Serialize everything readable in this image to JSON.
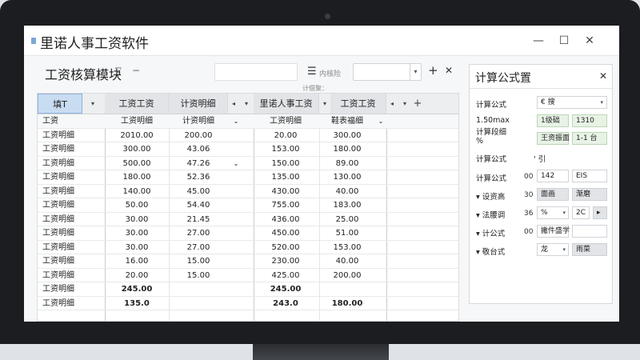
{
  "window": {
    "title": "里诺人事工资软件",
    "minimize": "—",
    "maximize": "☐",
    "close": "✕"
  },
  "module": {
    "title": "工资核算模块",
    "dropdown_arrow": "▽",
    "dash": "−",
    "list_label": "内核险",
    "plus": "+",
    "close": "✕",
    "hint": "计偿聚："
  },
  "grid": {
    "headers": [
      "填T",
      "工资工资",
      "计资明细",
      "里诺人事工资",
      "工资工资"
    ],
    "rows": [
      {
        "c0": "工资",
        "c1": "工资明细",
        "c2": "计资明细",
        "c2b": "⌄",
        "c4": "工资明细",
        "c5": "鞋表福细",
        "c5b": "⌄"
      },
      {
        "c0": "工资明细",
        "c1": "2010.00",
        "c2": "200.00",
        "c4": "20.00",
        "c5": "300.00"
      },
      {
        "c0": "工资明细",
        "c1": "300.00",
        "c2": "43.06",
        "c4": "153.00",
        "c5": "180.00"
      },
      {
        "c0": "工资明细",
        "c1": "500.00",
        "c2": "47.26",
        "c2b": "⌄",
        "c4": "150.00",
        "c5": "89.00"
      },
      {
        "c0": "工资明细",
        "c1": "180.00",
        "c2": "52.36",
        "c4": "135.00",
        "c5": "130.00"
      },
      {
        "c0": "工资明细",
        "c1": "140.00",
        "c2": "45.00",
        "c4": "430.00",
        "c5": "40.00"
      },
      {
        "c0": "工资明细",
        "c1": "50.00",
        "c2": "54.40",
        "c4": "755.00",
        "c5": "183.00"
      },
      {
        "c0": "工资明细",
        "c1": "30.00",
        "c2": "21.45",
        "c4": "436.00",
        "c5": "25.00"
      },
      {
        "c0": "工资明细",
        "c1": "30.00",
        "c2": "27.00",
        "c4": "450.00",
        "c5": "51.00"
      },
      {
        "c0": "工资明细",
        "c1": "30.00",
        "c2": "27.00",
        "c4": "520.00",
        "c5": "153.00"
      },
      {
        "c0": "工资明细",
        "c1": "16.00",
        "c2": "15.00",
        "c4": "230.00",
        "c5": "40.00"
      },
      {
        "c0": "工资明细",
        "c1": "20.00",
        "c2": "15.00",
        "c4": "425.00",
        "c5": "200.00"
      },
      {
        "c0": "工资明细",
        "c1": "245.00",
        "c1_bold": true,
        "c4": "245.00",
        "c4_bold": true
      },
      {
        "c0": "工资明细",
        "c1": "135.0",
        "c1_bold": true,
        "c4": "243.0",
        "c4_bold": true,
        "c5": "180.00",
        "c5_bold": true
      }
    ]
  },
  "panel": {
    "title": "计算公式置",
    "close": "✕",
    "rows": [
      {
        "label": "计算公式",
        "value": "€ 搜",
        "has_arrow": true
      },
      {
        "label": "1.50max",
        "box1": "1级础",
        "box2": "1310"
      },
      {
        "label": "计算段细",
        "box1": "王资振面",
        "box2": "1-1 台"
      },
      {
        "label": "%"
      },
      {
        "label": "计算公式",
        "value": "' 引"
      },
      {
        "label": "计算公式",
        "num": "00",
        "box1": "142",
        "box2": "EIS"
      },
      {
        "label": "▾ 设资高",
        "num": "30",
        "box1": "面画",
        "box2": "渐磨"
      },
      {
        "label": "▾ 法腰调",
        "num": "36",
        "box1": "%",
        "box2": "2C",
        "box3": "▸"
      },
      {
        "label": "▾ 计公式",
        "num": "00",
        "box1": "撇件盛学"
      },
      {
        "label": "▾ 敬台式",
        "box1": "龙",
        "box2": "雨菜"
      }
    ]
  }
}
